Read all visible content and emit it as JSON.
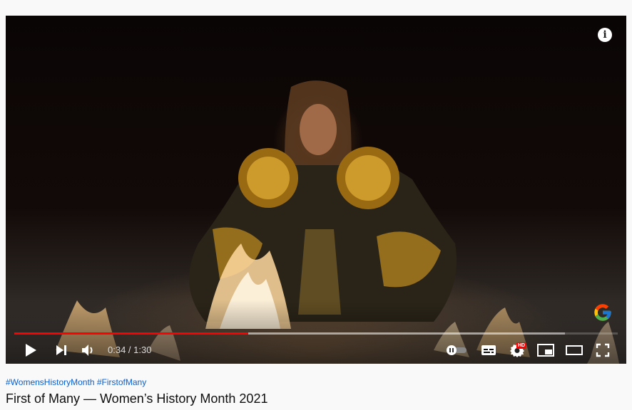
{
  "video": {
    "info_icon": "info-icon",
    "overlay_logo": "google-logo",
    "current_time": "0:34",
    "duration": "1:30",
    "time_separator": " / ",
    "progress_played": 0.388,
    "progress_loaded": 0.913,
    "hd_badge": "HD",
    "controls": {
      "play_icon": "play-icon",
      "next_icon": "next-icon",
      "volume_icon": "volume-icon",
      "autoplay_icon": "autoplay-toggle-icon",
      "captions_icon": "captions-icon",
      "settings_icon": "settings-icon",
      "miniplayer_icon": "miniplayer-icon",
      "theater_icon": "theater-mode-icon",
      "fullscreen_icon": "fullscreen-icon"
    },
    "colors": {
      "progress_played": "#ff0000",
      "hashtag_link": "#065fd4"
    }
  },
  "below": {
    "hashtags": [
      "#WomensHistoryMonth",
      "#FirstofMany"
    ],
    "title": "First of Many — Women’s History Month 2021"
  }
}
